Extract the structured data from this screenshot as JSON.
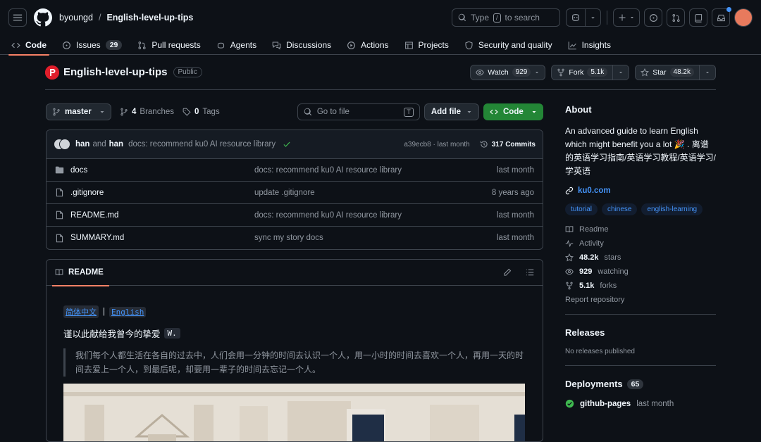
{
  "header": {
    "owner": "byoungd",
    "slash": "/",
    "repo": "English-level-up-tips",
    "search_type": "Type",
    "search_key": "/",
    "search_rest": "to search"
  },
  "nav": {
    "tabs": [
      {
        "label": "Code"
      },
      {
        "label": "Issues",
        "count": "29"
      },
      {
        "label": "Pull requests"
      },
      {
        "label": "Agents"
      },
      {
        "label": "Discussions"
      },
      {
        "label": "Actions"
      },
      {
        "label": "Projects"
      },
      {
        "label": "Security and quality"
      },
      {
        "label": "Insights"
      }
    ]
  },
  "repo": {
    "name": "English-level-up-tips",
    "visibility": "Public",
    "watch_label": "Watch",
    "watch_count": "929",
    "fork_label": "Fork",
    "fork_count": "5.1k",
    "star_label": "Star",
    "star_count": "48.2k"
  },
  "toolbar": {
    "branch": "master",
    "branches_count": "4",
    "branches_label": "Branches",
    "tags_count": "0",
    "tags_label": "Tags",
    "goto_placeholder": "Go to file",
    "goto_key": "T",
    "add_file": "Add file",
    "code": "Code"
  },
  "commit": {
    "author1": "han",
    "and": "and",
    "author2": "han",
    "message": "docs: recommend ku0 AI resource library",
    "sha_time": "a39ecb8 · last month",
    "commits": "317 Commits"
  },
  "files": [
    {
      "name": "docs",
      "type": "folder",
      "message": "docs: recommend ku0 AI resource library",
      "date": "last month"
    },
    {
      "name": ".gitignore",
      "type": "file",
      "message": "update .gitignore",
      "date": "8 years ago"
    },
    {
      "name": "README.md",
      "type": "file",
      "message": "docs: recommend ku0 AI resource library",
      "date": "last month"
    },
    {
      "name": "SUMMARY.md",
      "type": "file",
      "message": "sync my story docs",
      "date": "last month"
    }
  ],
  "readme": {
    "tab": "README",
    "lang_zh": "简体中文",
    "lang_sep": "|",
    "lang_en": "English",
    "dedication": "谨以此献给我曾今的挚爱",
    "dedication_code": "W.",
    "quote": "我们每个人都生活在各自的过去中，人们会用一分钟的时间去认识一个人，用一小时的时间去喜欢一个人，再用一天的时间去爱上一个人，到最后呢，却要用一辈子的时间去忘记一个人。"
  },
  "sidebar": {
    "about_heading": "About",
    "about_text": "An advanced guide to learn English which might benefit you a lot 🎉 . 离谱的英语学习指南/英语学习教程/英语学习/学英语",
    "link": "ku0.com",
    "topics": [
      "tutorial",
      "chinese",
      "english-learning"
    ],
    "readme": "Readme",
    "activity": "Activity",
    "stars": "48.2k",
    "stars_label": "stars",
    "watching": "929",
    "watching_label": "watching",
    "forks": "5.1k",
    "forks_label": "forks",
    "report": "Report repository",
    "releases_heading": "Releases",
    "releases_text": "No releases published",
    "deployments_heading": "Deployments",
    "deployments_count": "65",
    "deployment_name": "github-pages",
    "deployment_date": "last month"
  },
  "colors": {
    "accent_green": "#238636",
    "link_blue": "#4493f8",
    "tab_underline": "#f78166"
  }
}
